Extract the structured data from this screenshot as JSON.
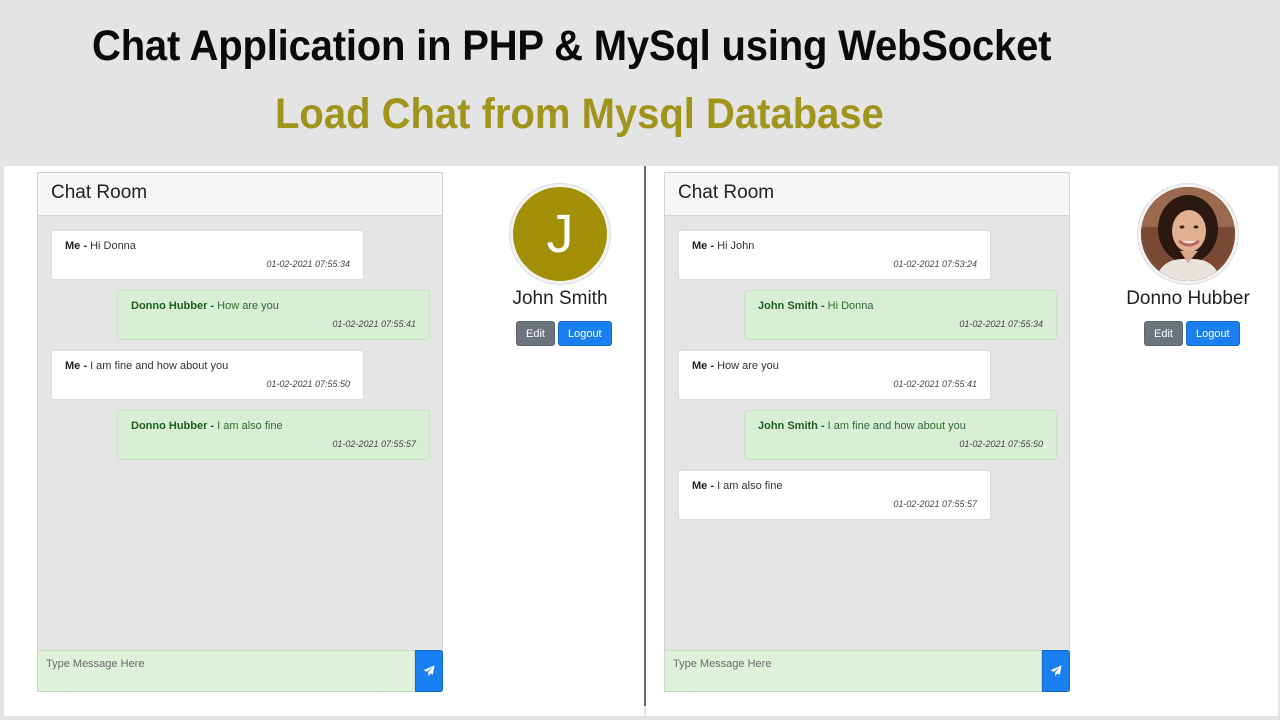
{
  "banner": {
    "title": "Chat Application in PHP & MySql using WebSocket",
    "subtitle": "Load Chat from Mysql Database"
  },
  "colors": {
    "subtitle": "#a1941a",
    "own_message_bg": "#ffffff",
    "other_message_bg": "#d8efd6",
    "avatar_bg": "#a38f06",
    "primary_button": "#1a7ff0",
    "secondary_button": "#6c757d"
  },
  "left": {
    "chat_title": "Chat Room",
    "messages": [
      {
        "from": "me",
        "sender": "Me - ",
        "text": "Hi Donna",
        "time": "01-02-2021 07:55:34"
      },
      {
        "from": "other",
        "sender": "Donno Hubber - ",
        "text": "How are you",
        "time": "01-02-2021 07:55:41"
      },
      {
        "from": "me",
        "sender": "Me - ",
        "text": "I am fine and how about you",
        "time": "01-02-2021 07:55:50"
      },
      {
        "from": "other",
        "sender": "Donno Hubber - ",
        "text": "I am also fine",
        "time": "01-02-2021 07:55:57"
      }
    ],
    "input_placeholder": "Type Message Here",
    "send_icon": "paper-plane-icon",
    "profile": {
      "avatar_letter": "J",
      "name": "John Smith",
      "edit_label": "Edit",
      "logout_label": "Logout"
    }
  },
  "right": {
    "chat_title": "Chat Room",
    "messages": [
      {
        "from": "me",
        "sender": "Me - ",
        "text": "Hi John",
        "time": "01-02-2021 07:53:24"
      },
      {
        "from": "other",
        "sender": "John Smith - ",
        "text": "Hi Donna",
        "time": "01-02-2021 07:55:34"
      },
      {
        "from": "me",
        "sender": "Me - ",
        "text": "How are you",
        "time": "01-02-2021 07:55:41"
      },
      {
        "from": "other",
        "sender": "John Smith - ",
        "text": "I am fine and how about you",
        "time": "01-02-2021 07:55:50"
      },
      {
        "from": "me",
        "sender": "Me - ",
        "text": "I am also fine",
        "time": "01-02-2021 07:55:57"
      }
    ],
    "input_placeholder": "Type Message Here",
    "send_icon": "paper-plane-icon",
    "profile": {
      "avatar_icon": "user-photo",
      "name": "Donno Hubber",
      "edit_label": "Edit",
      "logout_label": "Logout"
    }
  }
}
